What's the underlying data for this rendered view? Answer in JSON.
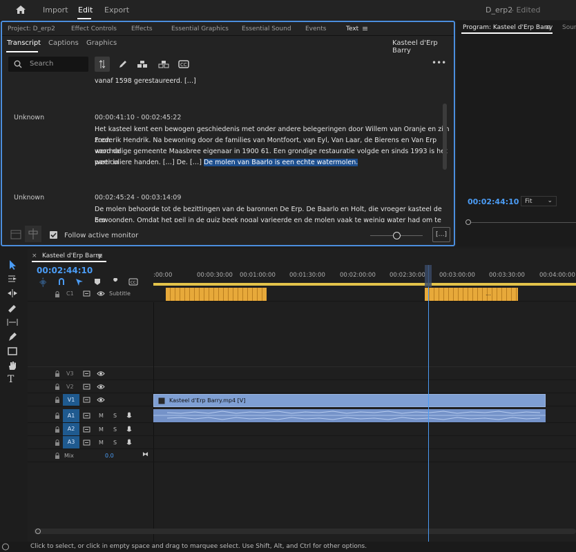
{
  "topbar": {
    "import": "Import",
    "edit": "Edit",
    "export": "Export",
    "project": "D_erp2",
    "edited": "- Edited"
  },
  "panel_tabs": [
    "Project: D_erp2",
    "Effect Controls",
    "Effects",
    "Essential Graphics",
    "Essential Sound",
    "Events",
    "Text"
  ],
  "text_subtabs": [
    "Transcript",
    "Captions",
    "Graphics"
  ],
  "clip_name": "Kasteel d'Erp Barry",
  "search": {
    "placeholder": "Search"
  },
  "transcript": {
    "prev_line": "vanaf 1598 gerestaureerd. […]",
    "block1": {
      "speaker": "Unknown",
      "timecode": "00:00:41:10 - 00:02:45:22",
      "text_a": "Het kasteel kent een bewogen geschiedenis met onder andere belegeringen door Willem van Oranje en zijn zoon",
      "text_b": "Frederik Hendrik. Na bewoning door de families van Montfoort, van Eyl, Van Laar, de Bierens en Van Erp werd de",
      "text_c": "voormalige gemeente Maasbree eigenaar in 1900 61. Een grondige restauratie volgde en sinds 1993 is het weer in",
      "text_d": "particuliere handen. […] De. […]",
      "text_highlight": "De molen van Baarlo is een echte watermolen."
    },
    "block2": {
      "speaker": "Unknown",
      "timecode": "00:02:45:24 - 00:03:14:09",
      "text_a": "De molen behoorde tot de bezittingen van de baronnen De Erp. De Baarlo en Holt, die vroeger kasteel de Erp",
      "text_b": "bewoonden. Omdat het peil in de quiz beek nogal varieerde en de molen vaak te weinig water had om te malen, liet"
    }
  },
  "follow_label": "Follow active monitor",
  "bracket_btn": "[…]",
  "program": {
    "title": "Program: Kasteel d'Erp Barry",
    "source": "Sourc",
    "timecode": "00:02:44:10",
    "fit": "Fit"
  },
  "timeline": {
    "sequence": "Kasteel d'Erp Barry",
    "timecode": "00:02:44:10",
    "ruler": [
      ":00:00",
      "00:00:30:00",
      "00:01:00:00",
      "00:01:30:00",
      "00:02:00:00",
      "00:02:30:00",
      "00:03:00:00",
      "00:03:30:00",
      "00:04:00:00"
    ],
    "subtitle_track": {
      "id": "C1",
      "label": "Subtitle"
    },
    "video_tracks": [
      "V3",
      "V2",
      "V1"
    ],
    "audio_tracks": [
      "A1",
      "A2",
      "A3"
    ],
    "mix": {
      "label": "Mix",
      "value": "0.0"
    },
    "video_clip": "Kasteel d'Erp Barry.mp4 [V]",
    "ms": [
      "M",
      "S"
    ],
    "subtitle_dots": "..."
  },
  "status": "Click to select, or click in empty space and drag to marquee select. Use Shift, Alt, and Ctrl for other options."
}
